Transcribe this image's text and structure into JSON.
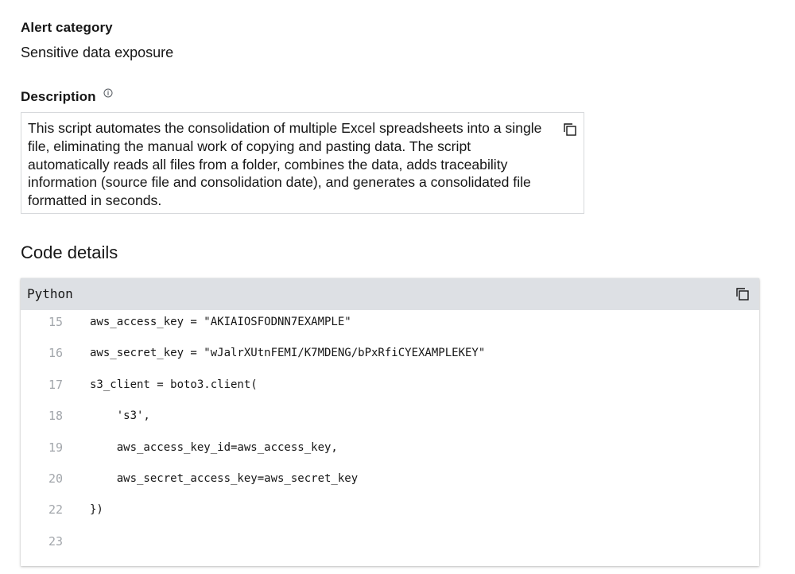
{
  "alert": {
    "category_label": "Alert category",
    "category_value": "Sensitive data exposure"
  },
  "description": {
    "label": "Description",
    "info_icon": "info-icon",
    "text": "This script automates the consolidation of multiple Excel spreadsheets into a single file, eliminating the manual work of copying and pasting data. The script automatically reads all files from a folder, combines the data, adds traceability information (source file and consolidation date), and generates a consolidated file formatted in seconds.",
    "copy_icon": "copy-icon"
  },
  "code": {
    "section_title": "Code details",
    "language": "Python",
    "copy_icon": "copy-icon",
    "lines": [
      {
        "number": "15",
        "code": "aws_access_key = \"AKIAIOSFODNN7EXAMPLE\""
      },
      {
        "number": "16",
        "code": "aws_secret_key = \"wJalrXUtnFEMI/K7MDENG/bPxRfiCYEXAMPLEKEY\""
      },
      {
        "number": "17",
        "code": "s3_client = boto3.client("
      },
      {
        "number": "18",
        "code": "    's3',"
      },
      {
        "number": "19",
        "code": "    aws_access_key_id=aws_access_key,"
      },
      {
        "number": "20",
        "code": "    aws_secret_access_key=aws_secret_key"
      },
      {
        "number": "22",
        "code": "})"
      },
      {
        "number": "23",
        "code": ""
      }
    ]
  },
  "colors": {
    "text": "#161616",
    "header_bg": "#dde0e4",
    "line_number": "#a2a6ab",
    "border": "#d7d9dc"
  }
}
